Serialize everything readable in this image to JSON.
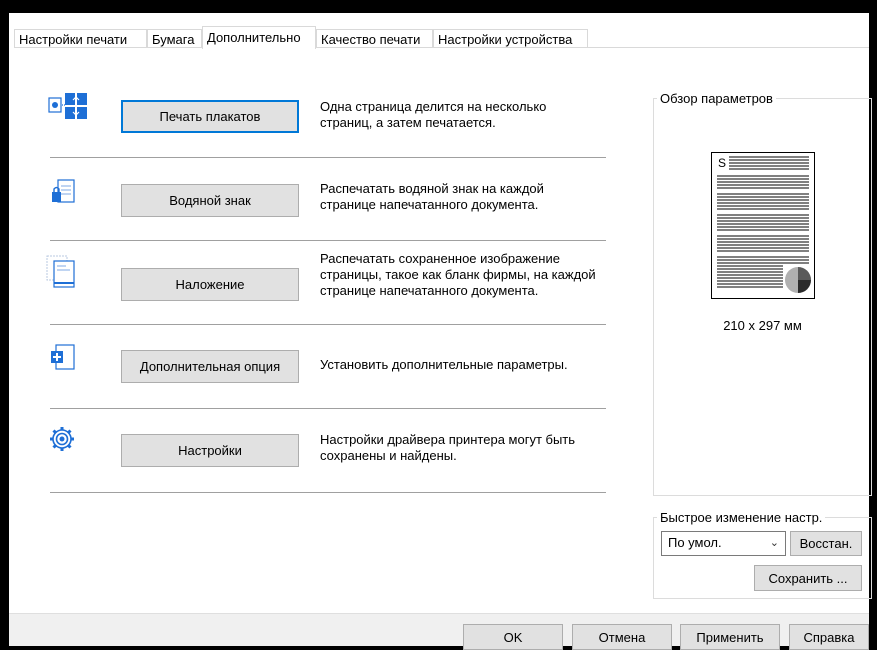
{
  "tabs": [
    "Настройки печати",
    "Бумага",
    "Дополнительно",
    "Качество печати",
    "Настройки устройства"
  ],
  "rows": [
    {
      "icon": "poster-icon",
      "button": "Печать плакатов",
      "desc": "Одна страница делится на несколько страниц, а затем печатается."
    },
    {
      "icon": "watermark-icon",
      "button": "Водяной знак",
      "desc": "Распечатать водяной знак на каждой странице напечатанного документа."
    },
    {
      "icon": "overlay-icon",
      "button": "Наложение",
      "desc": "Распечатать сохраненное изображение страницы, такое как бланк фирмы, на каждой странице напечатанного документа."
    },
    {
      "icon": "extra-option-icon",
      "button": "Дополнительная опция",
      "desc": "Установить дополнительные параметры."
    },
    {
      "icon": "settings-gear-icon",
      "button": "Настройки",
      "desc": "Настройки драйвера принтера могут быть сохранены и найдены."
    }
  ],
  "preview": {
    "title": "Обзор параметров",
    "page_letter": "S",
    "paper_size": "210 x 297 мм"
  },
  "quick": {
    "title": "Быстрое изменение настр.",
    "preset": "По умол.",
    "restore": "Восстан.",
    "save": "Сохранить ..."
  },
  "footer": {
    "ok": "OK",
    "cancel": "Отмена",
    "apply": "Применить",
    "help": "Справка"
  },
  "colors": {
    "accent": "#0078d7",
    "icon_blue": "#1e6fd6",
    "button_bg": "#e1e1e1"
  }
}
